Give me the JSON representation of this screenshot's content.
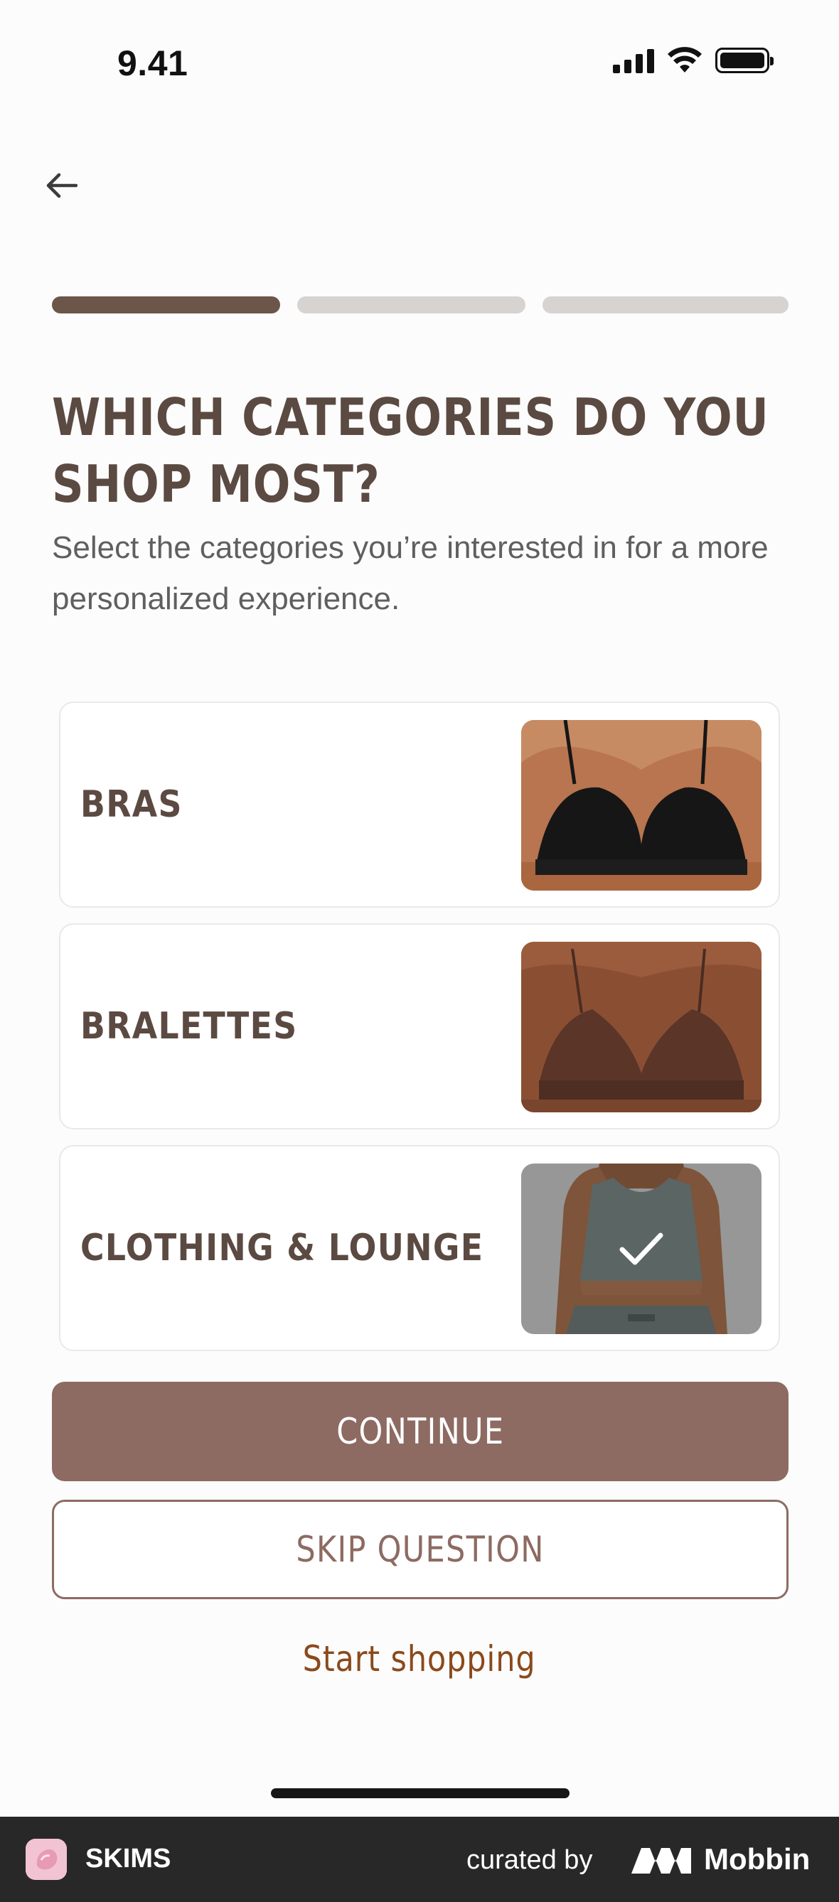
{
  "status_bar": {
    "time": "9.41"
  },
  "header": {
    "back_icon": "arrow-left-icon"
  },
  "progress": {
    "total_steps": 3,
    "current_step": 1
  },
  "question": {
    "title_line1": "WHICH CATEGORIES DO YOU",
    "title_line2": "SHOP MOST?",
    "subtitle": "Select the categories you’re interested in for a more personalized experience."
  },
  "categories": [
    {
      "label": "BRAS",
      "selected": false,
      "garment_color": "#161616"
    },
    {
      "label": "BRALETTES",
      "selected": false,
      "garment_color": "#5a3528"
    },
    {
      "label": "CLOTHING & LOUNGE",
      "selected": true,
      "garment_color": "#6f7c7a"
    }
  ],
  "actions": {
    "continue_label": "CONTINUE",
    "skip_label": "SKIP QUESTION",
    "start_shopping_label": "Start shopping"
  },
  "banner": {
    "app_name": "SKIMS",
    "curated_by": "curated by",
    "brand": "Mobbin"
  },
  "colors": {
    "primary": "#8d6b62",
    "title": "#5b4a42",
    "progress_active": "#6b5649",
    "progress_inactive": "#d6d3d1",
    "link": "#8a4a1c"
  }
}
